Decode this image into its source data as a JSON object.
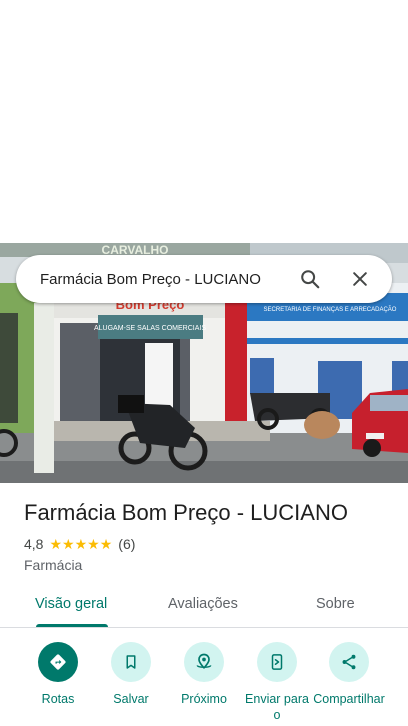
{
  "search": {
    "query": "Farmácia Bom Preço - LUCIANO"
  },
  "place": {
    "name": "Farmácia Bom Preço - LUCIANO",
    "rating": "4,8",
    "stars": 5,
    "review_count": "(6)",
    "category": "Farmácia"
  },
  "photo": {
    "sign_top": "CARVALHO",
    "sign_main": "Bom Preço",
    "banner": "ALUGAM-SE SALAS COMERCIAIS",
    "right_sign": "SECRETARIA DE FINANÇAS E ARRECADAÇÃO"
  },
  "tabs": [
    {
      "label": "Visão geral",
      "active": true
    },
    {
      "label": "Avaliações",
      "active": false
    },
    {
      "label": "Sobre",
      "active": false
    }
  ],
  "actions": [
    {
      "label": "Rotas",
      "icon": "directions-icon"
    },
    {
      "label": "Salvar",
      "icon": "bookmark-icon"
    },
    {
      "label": "Próximo",
      "icon": "nearby-icon"
    },
    {
      "label": "Enviar para o",
      "icon": "send-to-phone-icon"
    },
    {
      "label": "Compartilhar",
      "icon": "share-icon"
    }
  ],
  "colors": {
    "accent": "#00796b",
    "action_bg": "#d2f4f0",
    "star": "#fbbc04"
  }
}
